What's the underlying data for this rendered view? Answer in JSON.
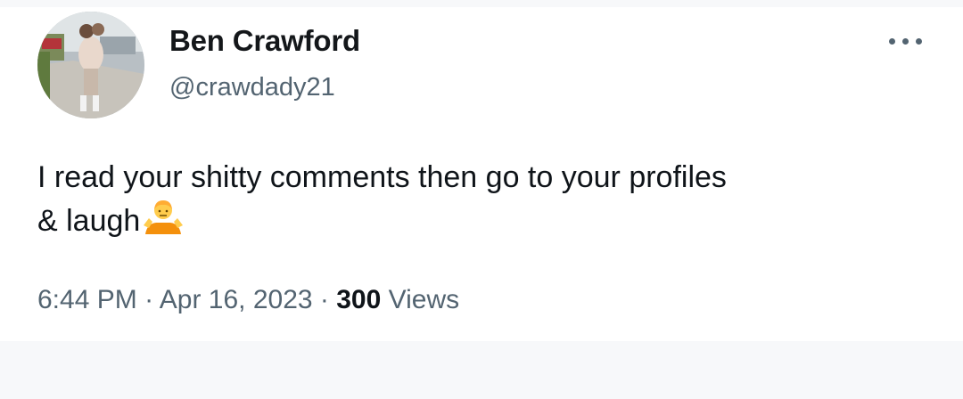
{
  "tweet": {
    "author_name": "Ben Crawford",
    "author_handle": "@crawdady21",
    "text_line1": "I read your shitty comments then go to your profiles",
    "text_line2": "& laugh",
    "emoji": "person-shrugging",
    "time": "6:44 PM",
    "separator": "·",
    "date": "Apr 16, 2023",
    "views_count": "300",
    "views_label": "Views"
  },
  "icons": {
    "more": "more-horizontal-icon"
  },
  "colors": {
    "text_primary": "#0f1419",
    "text_secondary": "#536471",
    "background": "#ffffff",
    "page_background": "#f7f8fa"
  }
}
